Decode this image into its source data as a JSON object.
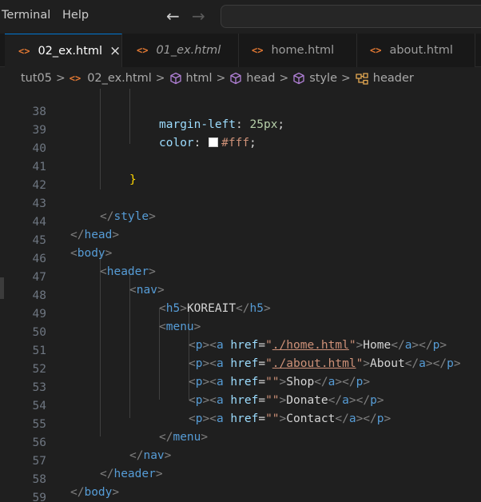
{
  "menu": {
    "terminal_label": "Terminal",
    "help_label": "Help",
    "back_icon": "arrow-left-icon",
    "forward_icon": "arrow-right-icon"
  },
  "tabs": [
    {
      "label": "02_ex.html",
      "active": true,
      "icon": "html-file-icon",
      "close": "×"
    },
    {
      "label": "01_ex.html",
      "active": false,
      "icon": "html-file-icon"
    },
    {
      "label": "home.html",
      "active": false,
      "icon": "html-file-icon"
    },
    {
      "label": "about.html",
      "active": false,
      "icon": "html-file-icon"
    }
  ],
  "breadcrumb": {
    "folder": "tut05",
    "file": "02_ex.html",
    "items": [
      "html",
      "head",
      "style",
      "header"
    ],
    "file_icon": "html-file-icon",
    "element_icon": "cube-icon",
    "selector_icon": "selector-icon"
  },
  "editor": {
    "line_numbers": [
      "38",
      "39",
      "40",
      "41",
      "42",
      "43",
      "44",
      "45",
      "46",
      "47",
      "48",
      "49",
      "50",
      "51",
      "52",
      "53",
      "54",
      "55",
      "56",
      "57",
      "58",
      "59"
    ],
    "code": {
      "l38_prop": "margin-left",
      "l38_val": "25px",
      "l39_prop": "color",
      "l39_val": "#fff",
      "l41_brace": "}",
      "tag_style": "style",
      "tag_head": "head",
      "tag_body": "body",
      "tag_header": "header",
      "tag_nav": "nav",
      "tag_h5": "h5",
      "h5_text": "KOREAIT",
      "tag_menu": "menu",
      "tag_p": "p",
      "tag_a": "a",
      "attr_href": "href",
      "tag_html": "html",
      "links": [
        {
          "href": "./home.html",
          "text": "Home"
        },
        {
          "href": "./about.html",
          "text": "About"
        },
        {
          "href": "",
          "text": "Shop"
        },
        {
          "href": "",
          "text": "Donate"
        },
        {
          "href": "",
          "text": "Contact"
        }
      ]
    },
    "colors": {
      "swatch": "#ffffff",
      "tag": "#569cd6",
      "attr": "#9cdcfe",
      "string": "#ce9178",
      "bracket": "#808080",
      "brace": "#ffd700"
    }
  }
}
